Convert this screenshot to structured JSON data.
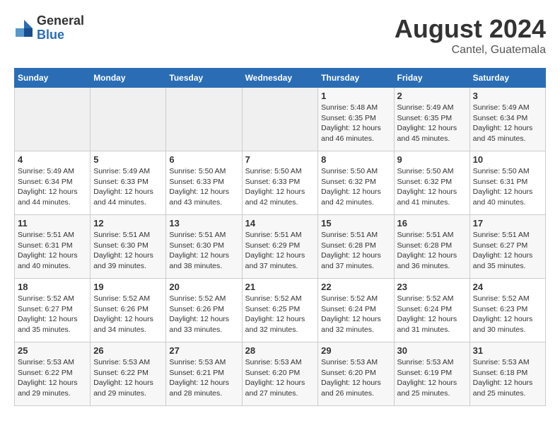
{
  "header": {
    "logo_general": "General",
    "logo_blue": "Blue",
    "month_year": "August 2024",
    "location": "Cantel, Guatemala"
  },
  "weekdays": [
    "Sunday",
    "Monday",
    "Tuesday",
    "Wednesday",
    "Thursday",
    "Friday",
    "Saturday"
  ],
  "weeks": [
    [
      {
        "day": "",
        "info": ""
      },
      {
        "day": "",
        "info": ""
      },
      {
        "day": "",
        "info": ""
      },
      {
        "day": "",
        "info": ""
      },
      {
        "day": "1",
        "info": "Sunrise: 5:48 AM\nSunset: 6:35 PM\nDaylight: 12 hours\nand 46 minutes."
      },
      {
        "day": "2",
        "info": "Sunrise: 5:49 AM\nSunset: 6:35 PM\nDaylight: 12 hours\nand 45 minutes."
      },
      {
        "day": "3",
        "info": "Sunrise: 5:49 AM\nSunset: 6:34 PM\nDaylight: 12 hours\nand 45 minutes."
      }
    ],
    [
      {
        "day": "4",
        "info": "Sunrise: 5:49 AM\nSunset: 6:34 PM\nDaylight: 12 hours\nand 44 minutes."
      },
      {
        "day": "5",
        "info": "Sunrise: 5:49 AM\nSunset: 6:33 PM\nDaylight: 12 hours\nand 44 minutes."
      },
      {
        "day": "6",
        "info": "Sunrise: 5:50 AM\nSunset: 6:33 PM\nDaylight: 12 hours\nand 43 minutes."
      },
      {
        "day": "7",
        "info": "Sunrise: 5:50 AM\nSunset: 6:33 PM\nDaylight: 12 hours\nand 42 minutes."
      },
      {
        "day": "8",
        "info": "Sunrise: 5:50 AM\nSunset: 6:32 PM\nDaylight: 12 hours\nand 42 minutes."
      },
      {
        "day": "9",
        "info": "Sunrise: 5:50 AM\nSunset: 6:32 PM\nDaylight: 12 hours\nand 41 minutes."
      },
      {
        "day": "10",
        "info": "Sunrise: 5:50 AM\nSunset: 6:31 PM\nDaylight: 12 hours\nand 40 minutes."
      }
    ],
    [
      {
        "day": "11",
        "info": "Sunrise: 5:51 AM\nSunset: 6:31 PM\nDaylight: 12 hours\nand 40 minutes."
      },
      {
        "day": "12",
        "info": "Sunrise: 5:51 AM\nSunset: 6:30 PM\nDaylight: 12 hours\nand 39 minutes."
      },
      {
        "day": "13",
        "info": "Sunrise: 5:51 AM\nSunset: 6:30 PM\nDaylight: 12 hours\nand 38 minutes."
      },
      {
        "day": "14",
        "info": "Sunrise: 5:51 AM\nSunset: 6:29 PM\nDaylight: 12 hours\nand 37 minutes."
      },
      {
        "day": "15",
        "info": "Sunrise: 5:51 AM\nSunset: 6:28 PM\nDaylight: 12 hours\nand 37 minutes."
      },
      {
        "day": "16",
        "info": "Sunrise: 5:51 AM\nSunset: 6:28 PM\nDaylight: 12 hours\nand 36 minutes."
      },
      {
        "day": "17",
        "info": "Sunrise: 5:51 AM\nSunset: 6:27 PM\nDaylight: 12 hours\nand 35 minutes."
      }
    ],
    [
      {
        "day": "18",
        "info": "Sunrise: 5:52 AM\nSunset: 6:27 PM\nDaylight: 12 hours\nand 35 minutes."
      },
      {
        "day": "19",
        "info": "Sunrise: 5:52 AM\nSunset: 6:26 PM\nDaylight: 12 hours\nand 34 minutes."
      },
      {
        "day": "20",
        "info": "Sunrise: 5:52 AM\nSunset: 6:26 PM\nDaylight: 12 hours\nand 33 minutes."
      },
      {
        "day": "21",
        "info": "Sunrise: 5:52 AM\nSunset: 6:25 PM\nDaylight: 12 hours\nand 32 minutes."
      },
      {
        "day": "22",
        "info": "Sunrise: 5:52 AM\nSunset: 6:24 PM\nDaylight: 12 hours\nand 32 minutes."
      },
      {
        "day": "23",
        "info": "Sunrise: 5:52 AM\nSunset: 6:24 PM\nDaylight: 12 hours\nand 31 minutes."
      },
      {
        "day": "24",
        "info": "Sunrise: 5:52 AM\nSunset: 6:23 PM\nDaylight: 12 hours\nand 30 minutes."
      }
    ],
    [
      {
        "day": "25",
        "info": "Sunrise: 5:53 AM\nSunset: 6:22 PM\nDaylight: 12 hours\nand 29 minutes."
      },
      {
        "day": "26",
        "info": "Sunrise: 5:53 AM\nSunset: 6:22 PM\nDaylight: 12 hours\nand 29 minutes."
      },
      {
        "day": "27",
        "info": "Sunrise: 5:53 AM\nSunset: 6:21 PM\nDaylight: 12 hours\nand 28 minutes."
      },
      {
        "day": "28",
        "info": "Sunrise: 5:53 AM\nSunset: 6:20 PM\nDaylight: 12 hours\nand 27 minutes."
      },
      {
        "day": "29",
        "info": "Sunrise: 5:53 AM\nSunset: 6:20 PM\nDaylight: 12 hours\nand 26 minutes."
      },
      {
        "day": "30",
        "info": "Sunrise: 5:53 AM\nSunset: 6:19 PM\nDaylight: 12 hours\nand 25 minutes."
      },
      {
        "day": "31",
        "info": "Sunrise: 5:53 AM\nSunset: 6:18 PM\nDaylight: 12 hours\nand 25 minutes."
      }
    ]
  ]
}
